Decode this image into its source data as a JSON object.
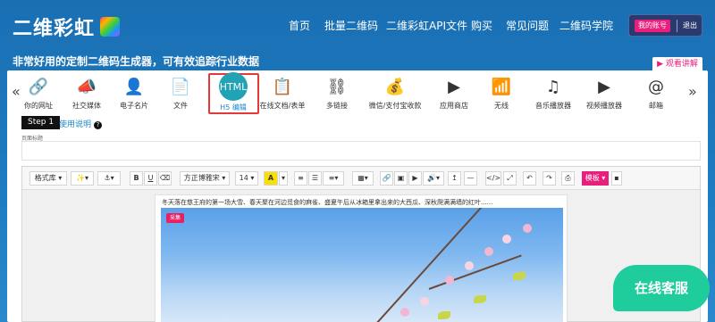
{
  "header": {
    "logo_text": "二维彩虹",
    "nav": [
      "首页",
      "批量二维码",
      "二维彩虹API文件",
      "购买",
      "常见问题",
      "二维码学院"
    ],
    "account_label": "我的账号",
    "logout_label": "退出"
  },
  "tagline": "非常好用的定制二维码生成器，可有效追踪行业数据",
  "tutorial_label": "▶ 观看讲解",
  "tools": [
    {
      "label": "你的网址",
      "icon": "link-icon",
      "glyph": "🔗"
    },
    {
      "label": "社交媒体",
      "icon": "megaphone-icon",
      "glyph": "📣"
    },
    {
      "label": "电子名片",
      "icon": "person-icon",
      "glyph": "👤"
    },
    {
      "label": "文件",
      "icon": "pdf-file-icon",
      "glyph": "📄"
    },
    {
      "label": "H5 编辑",
      "icon": "html-editor-icon",
      "glyph": "HTML",
      "active": true
    },
    {
      "label": "在线文档/表单",
      "icon": "document-icon",
      "glyph": "📋"
    },
    {
      "label": "多链接",
      "icon": "network-icon",
      "glyph": "⛓"
    },
    {
      "label": "微信/支付宝收款",
      "icon": "payment-icon",
      "glyph": "💰"
    },
    {
      "label": "应用商店",
      "icon": "app-store-icon",
      "glyph": "▶"
    },
    {
      "label": "无线",
      "icon": "wifi-icon",
      "glyph": "📶"
    },
    {
      "label": "音乐播放器",
      "icon": "music-icon",
      "glyph": "♫"
    },
    {
      "label": "视频播放器",
      "icon": "video-icon",
      "glyph": "▶"
    },
    {
      "label": "邮箱",
      "icon": "email-icon",
      "glyph": "@"
    }
  ],
  "step_label": "Step 1",
  "howto_label": "使用说明",
  "title_field_label": "页面标题",
  "title_value": "",
  "toolbar": {
    "format": "格式库 ▾",
    "font": "方正博雅宋 ▾",
    "size": "14 ▾",
    "template": "模板 ▾"
  },
  "article_text": "冬天落在慈王府的第一场大雪、春天聚在河边觅食的麻雀、盛夏午后从冰箱里拿出来的大西瓜、深秋爬满满墙的红叶......",
  "photo_tag": "采集",
  "chat_label": "在线客服",
  "colors": {
    "accent": "#e91e7d",
    "active_tool": "#21a2b5",
    "chat": "#1fcc9b"
  }
}
